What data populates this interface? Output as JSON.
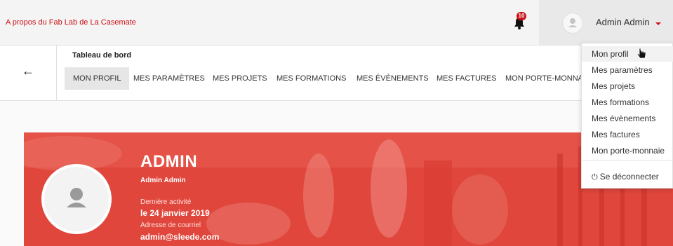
{
  "topbar": {
    "about_link": "A propos du Fab Lab de La Casemate",
    "notifications_count": "10",
    "user_name": "Admin Admin"
  },
  "subheader": {
    "title": "Tableau de bord",
    "tabs": [
      {
        "label": "MON PROFIL",
        "active": true
      },
      {
        "label": "MES PARAMÈTRES",
        "active": false
      },
      {
        "label": "MES PROJETS",
        "active": false
      },
      {
        "label": "MES FORMATIONS",
        "active": false
      },
      {
        "label": "MES ÉVÈNEMENTS",
        "active": false
      },
      {
        "label": "MES FACTURES",
        "active": false
      },
      {
        "label": "MON PORTE-MONNAIE",
        "active": false
      }
    ]
  },
  "profile": {
    "name": "ADMIN",
    "full_name": "Admin Admin",
    "last_activity_label": "Dernière activité",
    "last_activity_value": "le 24 janvier 2019",
    "email_label": "Adresse de courriel",
    "email_value": "admin@sleede.com"
  },
  "dropdown": {
    "items": [
      "Mon profil",
      "Mes paramètres",
      "Mes projets",
      "Mes formations",
      "Mes évènements",
      "Mes factures",
      "Mon porte-monnaie"
    ],
    "logout": "Se déconnecter"
  },
  "colors": {
    "brand_red": "#cb1117",
    "banner_red": "#e2483e"
  },
  "icons": [
    "bell-icon",
    "user-icon",
    "caret-down-icon",
    "back-arrow-icon",
    "power-icon",
    "hand-cursor-icon"
  ]
}
